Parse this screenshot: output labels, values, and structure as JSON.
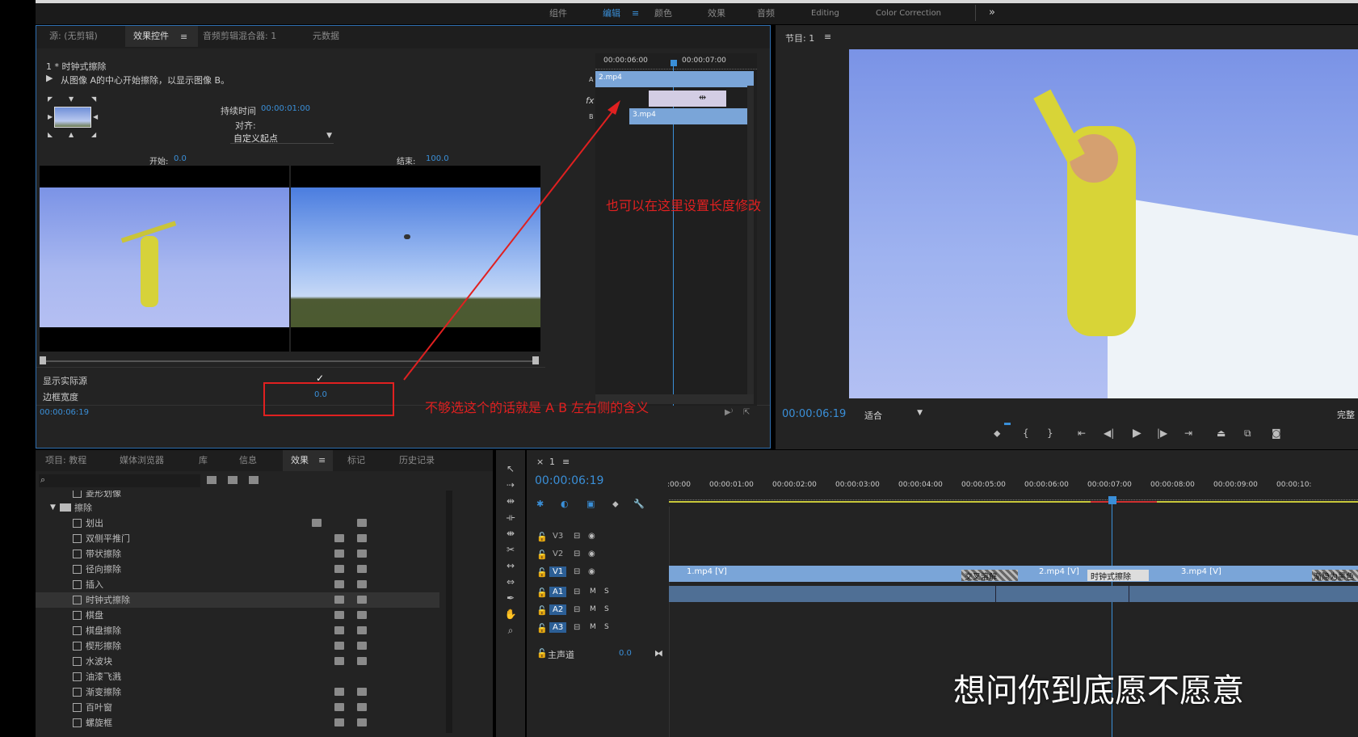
{
  "workspace": {
    "tabs": [
      "组件",
      "编辑",
      "颜色",
      "效果",
      "音频",
      "Editing",
      "Color Correction"
    ],
    "more": "»"
  },
  "effect_controls": {
    "tabs": [
      "源: (无剪辑)",
      "效果控件",
      "音频剪辑混合器: 1",
      "元数据"
    ],
    "clip_name": "1 * 时钟式擦除",
    "description": "从图像 A的中心开始擦除，以显示图像 B。",
    "duration_label": "持续时间",
    "duration_value": "00:00:01:00",
    "align_label": "对齐:",
    "align_value": "自定义起点",
    "start_label": "开始:",
    "start_value": "0.0",
    "end_label": "结束:",
    "end_value": "100.0",
    "show_actual_label": "显示实际源",
    "show_actual_check": "✓",
    "border_width_label": "边框宽度",
    "border_width_value": "0.0",
    "timecode": "00:00:06:19",
    "mini_timeline": {
      "time1": "00:00:06:00",
      "time2": "00:00:07:00",
      "track_a_label": "A",
      "track_b_label": "B",
      "fx_label": "fx",
      "clip_a": "2.mp4",
      "clip_b": "3.mp4"
    }
  },
  "annotations": {
    "note1": "也可以在这里设置长度修改",
    "note2": "不够选这个的话就是 A B 左右侧的含义",
    "color": "#e02020"
  },
  "program_monitor": {
    "title": "节目: 1",
    "timecode": "00:00:06:19",
    "fit_label": "适合",
    "quality_label": "完整"
  },
  "project_panel": {
    "tabs": [
      "项目: 教程",
      "媒体浏览器",
      "库",
      "信息",
      "效果",
      "标记",
      "历史记录"
    ],
    "partial_item": "菱形划像",
    "folder_label": "擦除",
    "items": [
      "划出",
      "双侧平推门",
      "带状擦除",
      "径向擦除",
      "插入",
      "时钟式擦除",
      "棋盘",
      "棋盘擦除",
      "楔形擦除",
      "水波块",
      "油漆飞溅",
      "渐变擦除",
      "百叶窗",
      "螺旋框"
    ]
  },
  "timeline": {
    "sequence_tab": "1",
    "timecode": "00:00:06:19",
    "ruler": [
      ":00:00",
      "00:00:01:00",
      "00:00:02:00",
      "00:00:03:00",
      "00:00:04:00",
      "00:00:05:00",
      "00:00:06:00",
      "00:00:07:00",
      "00:00:08:00",
      "00:00:09:00",
      "00:00:10:"
    ],
    "video_tracks": [
      "V3",
      "V2",
      "V1"
    ],
    "audio_tracks": [
      "A1",
      "A2",
      "A3"
    ],
    "master_label": "主声道",
    "master_value": "0.0",
    "clips": [
      "1.mp4 [V]",
      "2.mp4 [V]",
      "3.mp4 [V]"
    ],
    "transitions": [
      "交叉溶解",
      "时钟式擦除",
      "渐隐为黑色"
    ],
    "m_label": "M",
    "s_label": "S"
  },
  "subtitle": "想问你到底愿不愿意"
}
